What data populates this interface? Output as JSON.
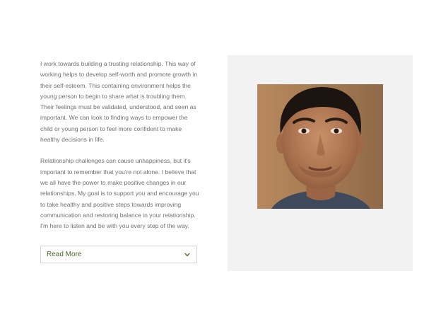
{
  "content": {
    "paragraphs": [
      "I work towards building a trusting relationship. This way of working helps to develop self-worth and promote growth in their self-esteem. This containing environment helps the young person to begin to share what is troubling them. Their feelings must be validated, understood, and seen as important. We can look to finding ways to empower the child or young person to feel more confident to make healthy decisions in life.",
      "Relationship challenges can cause unhappiness, but it's important to remember that you're not alone. I believe that we all have the power to make positive changes in our relationships. My goal is to support you and encourage you to take healthy and positive steps towards improving communication and restoring balance in your relationship. I'm here to listen and be with you every step of the way."
    ],
    "read_more_label": "Read More"
  },
  "icons": {
    "read_more_icon": "chevron-down-icon"
  },
  "colors": {
    "accent": "#4a6b2a",
    "body_text": "#707070",
    "panel_bg": "#f2f2f2"
  }
}
